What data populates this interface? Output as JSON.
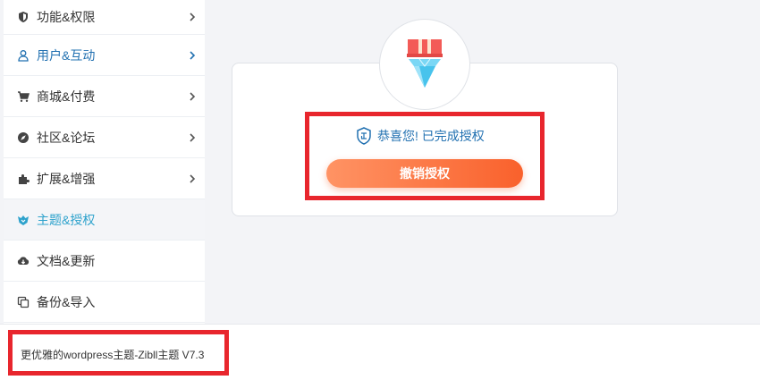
{
  "sidebar": {
    "items": [
      {
        "label": "功能&权限",
        "icon": "shield-icon"
      },
      {
        "label": "用户&互动",
        "icon": "user-icon"
      },
      {
        "label": "商城&付费",
        "icon": "cart-icon"
      },
      {
        "label": "社区&论坛",
        "icon": "compass-icon"
      },
      {
        "label": "扩展&增强",
        "icon": "puzzle-icon"
      },
      {
        "label": "主题&授权",
        "icon": "theme-logo-icon"
      },
      {
        "label": "文档&更新",
        "icon": "cloud-download-icon"
      },
      {
        "label": "备份&导入",
        "icon": "copy-icon"
      }
    ]
  },
  "license": {
    "status_text": "恭喜您! 已完成授权",
    "revoke_label": "撤销授权"
  },
  "footer": {
    "version_text": "更优雅的wordpress主题-Zibll主题 V7.3"
  },
  "colors": {
    "accent_blue": "#2271b1",
    "button_orange_start": "#ff9364",
    "button_orange_end": "#f9612c",
    "highlight_red": "#e8262d"
  }
}
